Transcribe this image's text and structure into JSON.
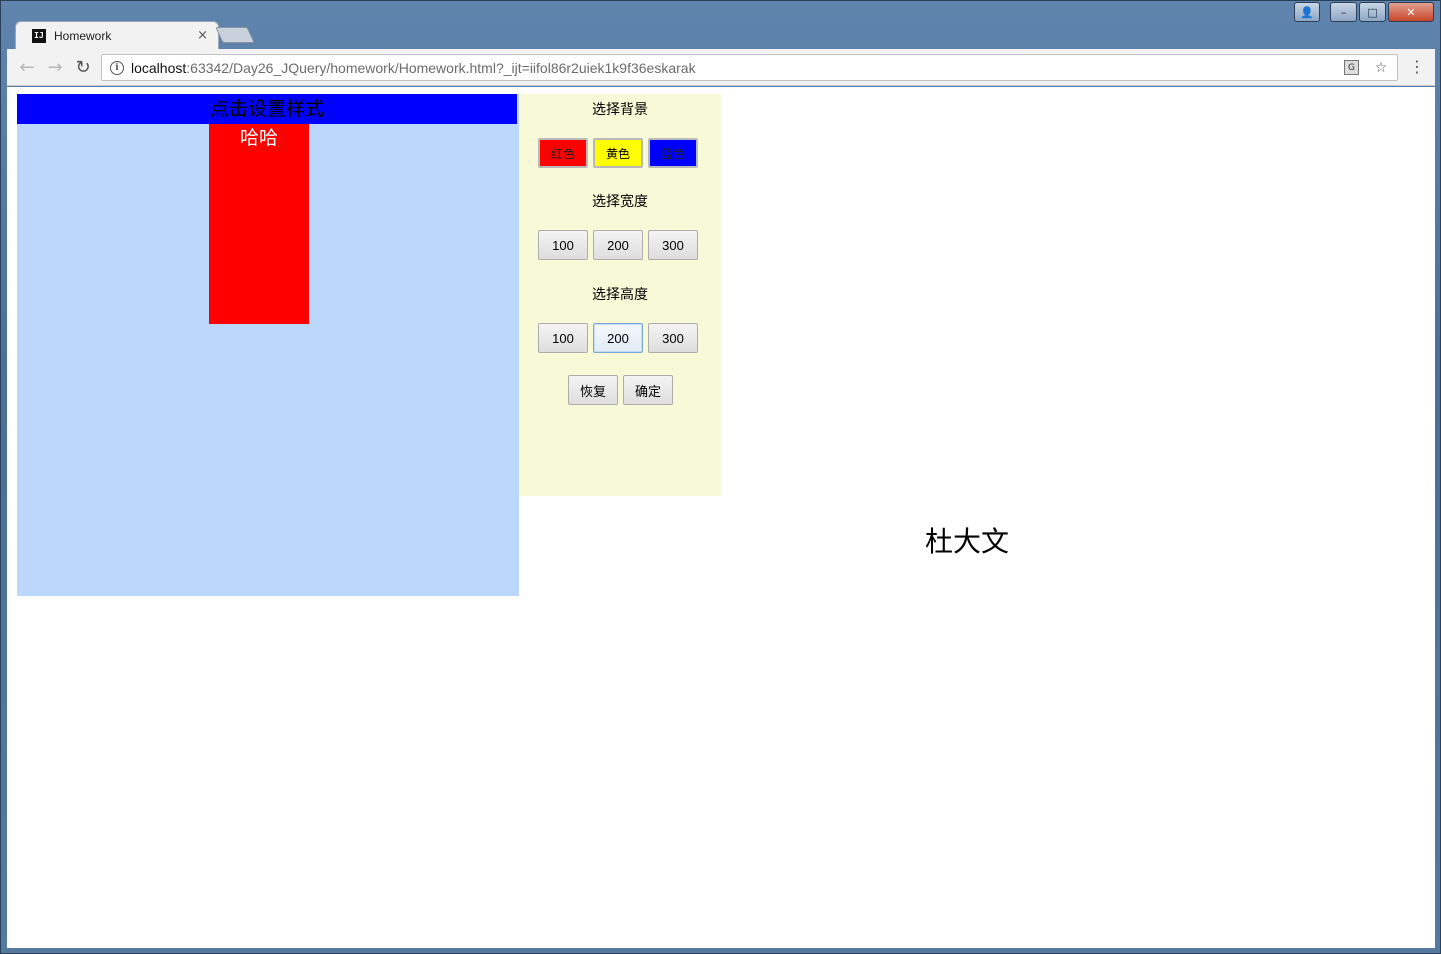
{
  "browser": {
    "tab_title": "Homework",
    "tab_favicon_text": "IJ",
    "tab_close": "×",
    "url_host": "localhost",
    "url_rest": ":63342/Day26_JQuery/homework/Homework.html?_ijt=iifol86r2uiek1k9f36eskarak",
    "nav_back": "←",
    "nav_forward": "→",
    "nav_reload": "↻",
    "info_icon": "i",
    "star_icon": "☆",
    "translate_icon": "G",
    "menu_icon": "⋮"
  },
  "window": {
    "user_icon": "👤",
    "minimize": "–",
    "maximize": "□",
    "close": "✕"
  },
  "page": {
    "header_text": "点击设置样式",
    "target_text": "哈哈",
    "name_text": "杜大文",
    "panel": {
      "bg_heading": "选择背景",
      "bg_buttons": [
        "红色",
        "黄色",
        "蓝色"
      ],
      "width_heading": "选择宽度",
      "width_buttons": [
        "100",
        "200",
        "300"
      ],
      "height_heading": "选择高度",
      "height_buttons": [
        "100",
        "200",
        "300"
      ],
      "reset_label": "恢复",
      "confirm_label": "确定"
    }
  },
  "colors": {
    "header_bg": "#0000fe",
    "main_box_bg": "#bcd7fc",
    "target_bg": "#fe0000",
    "panel_bg": "#f8f9d7",
    "red": "#fe0000",
    "yellow": "#fefe00",
    "blue": "#0000fe"
  }
}
